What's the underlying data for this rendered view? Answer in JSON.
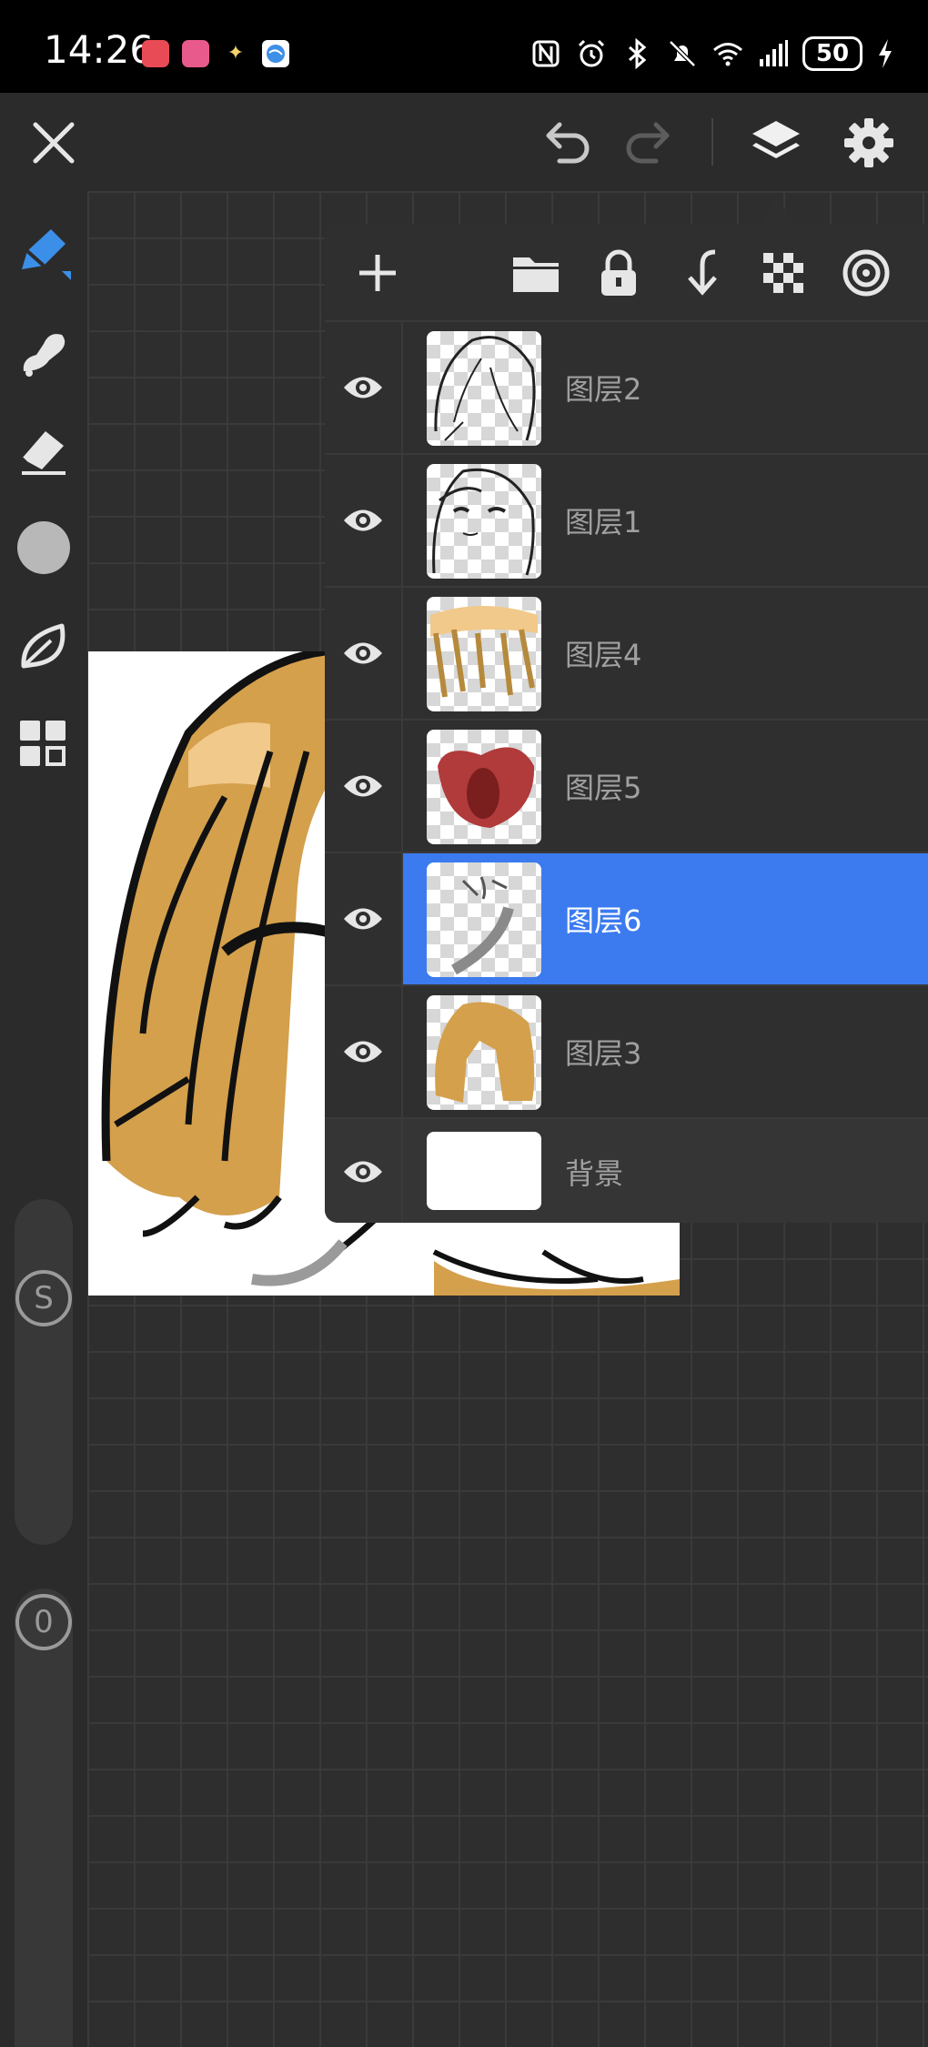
{
  "status_bar": {
    "time": "14:26",
    "battery": "50"
  },
  "colors": {
    "accent": "#3b7bef",
    "panel_bg": "#2f2f2f",
    "canvas_bg": "#2e2e2e",
    "icon": "#e6e6e6",
    "brush_active": "#3b8fe8",
    "hair": "#d4a04c"
  },
  "left_tools": [
    {
      "icon": "pen-icon",
      "active": true
    },
    {
      "icon": "smudge-icon"
    },
    {
      "icon": "eraser-icon"
    },
    {
      "icon": "color-swatch-icon"
    },
    {
      "icon": "leaf-icon"
    },
    {
      "icon": "grid-menu-icon"
    }
  ],
  "sliders": {
    "size_label": "S",
    "opacity_label": "0"
  },
  "layers": [
    {
      "name": "图层2",
      "visible": true
    },
    {
      "name": "图层1",
      "visible": true
    },
    {
      "name": "图层4",
      "visible": true
    },
    {
      "name": "图层5",
      "visible": true
    },
    {
      "name": "图层6",
      "visible": true,
      "selected": true
    },
    {
      "name": "图层3",
      "visible": true
    }
  ],
  "background_layer": {
    "name": "背景",
    "visible": true
  }
}
